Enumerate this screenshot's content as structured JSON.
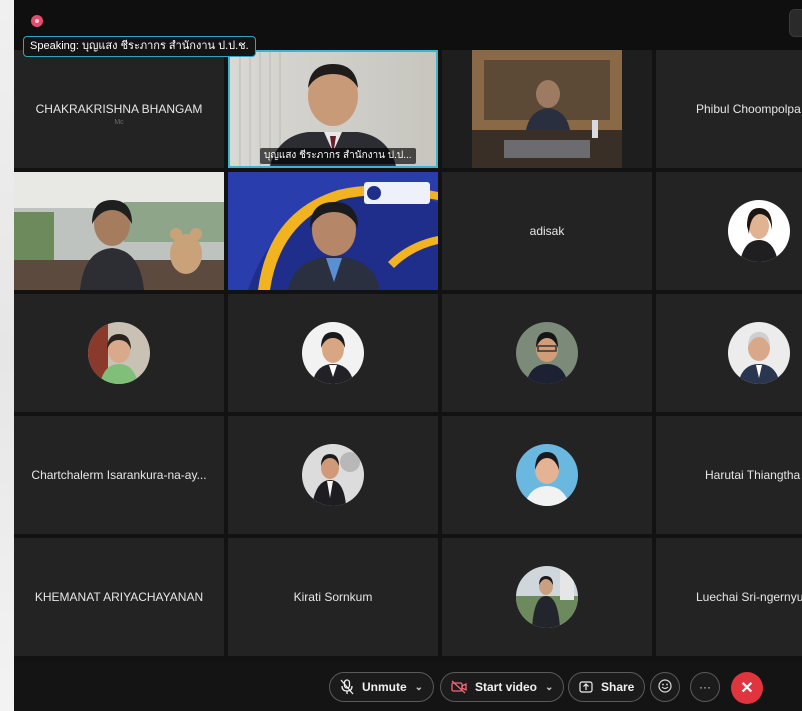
{
  "meeting": {
    "speaking_label": "Speaking: บุญแสง ชีระภากร สำนักงาน ป.ป.ช."
  },
  "tiles": [
    {
      "name": "CHAKRAKRISHNA BHANGAM",
      "subtitle": "Mc"
    },
    {
      "name": "บุญแสง ชีระภากร สำนักงาน ป.ป..."
    },
    {
      "name": ""
    },
    {
      "name": "Phibul Choompolpa"
    },
    {
      "name": ""
    },
    {
      "name": ""
    },
    {
      "name": "adisak"
    },
    {
      "name": ""
    },
    {
      "name": ""
    },
    {
      "name": ""
    },
    {
      "name": ""
    },
    {
      "name": ""
    },
    {
      "name": "Chartchalerm Isarankura-na-ay..."
    },
    {
      "name": ""
    },
    {
      "name": ""
    },
    {
      "name": "Harutai Thiangtha"
    },
    {
      "name": "KHEMANAT ARIYACHAYANAN"
    },
    {
      "name": "Kirati Sornkum"
    },
    {
      "name": ""
    },
    {
      "name": "Luechai Sri-ngernyu"
    }
  ],
  "toolbar": {
    "unmute": "Unmute",
    "start_video": "Start video",
    "share": "Share",
    "more": "···"
  },
  "colors": {
    "active_border": "#3fb4cf",
    "end_call": "#e0353f",
    "recording": "#e74a6d"
  },
  "icons": [
    "microphone-muted-icon",
    "video-off-icon",
    "share-icon",
    "reactions-icon",
    "more-icon",
    "end-call-icon",
    "recording-icon"
  ]
}
